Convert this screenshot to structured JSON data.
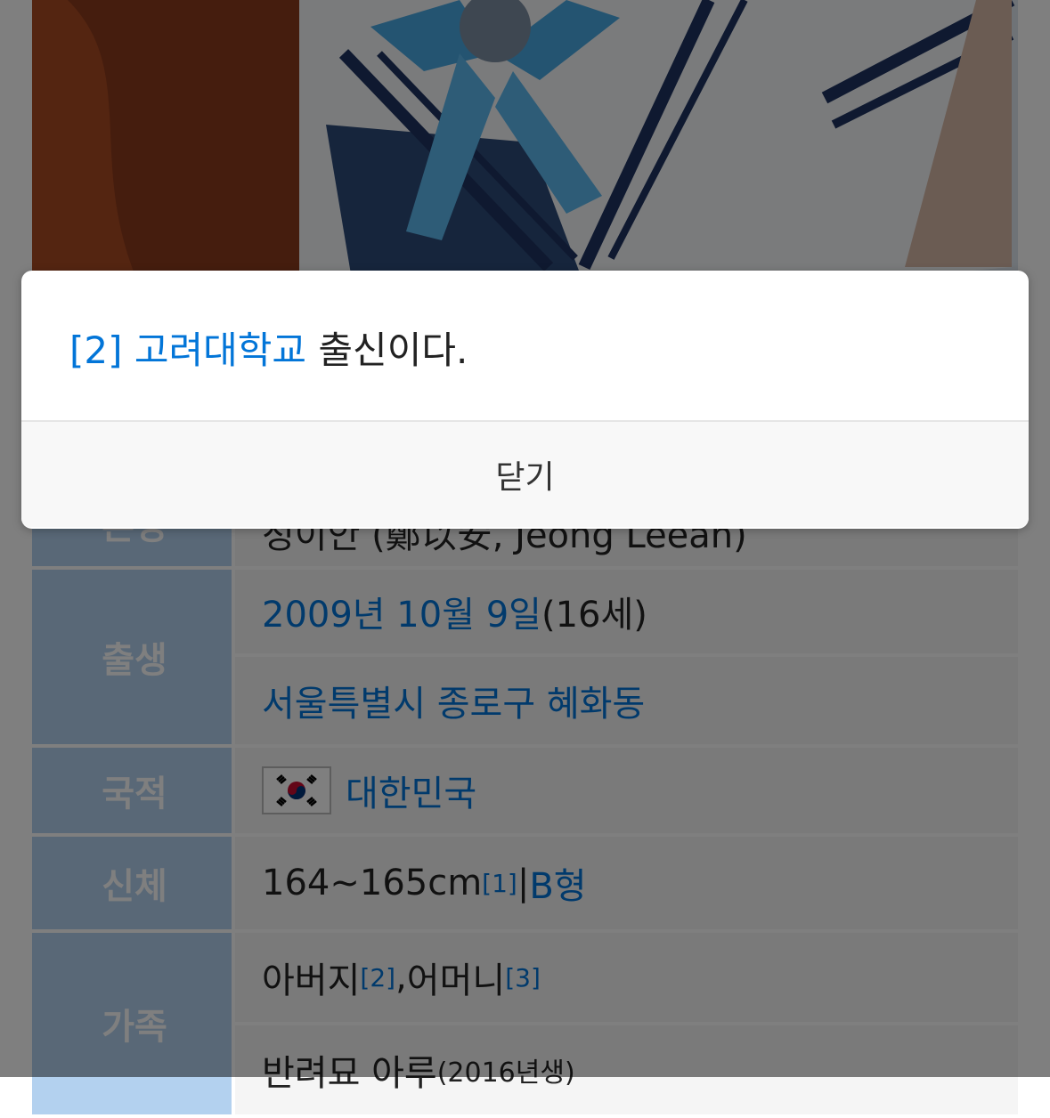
{
  "modal": {
    "footnote_ref": "[2]",
    "footnote_link": "고려대학교",
    "footnote_rest": " 출신이다.",
    "close_label": "닫기"
  },
  "infobox": {
    "name_row": {
      "label": "본명",
      "value": "정이안 (鄭以安, Jeong Leean)"
    },
    "birth_row": {
      "label": "출생",
      "date_link": "2009년 10월 9일",
      "age": " (16세)",
      "place_link": "서울특별시 종로구 혜화동"
    },
    "nationality_row": {
      "label": "국적",
      "flag_icon": "south-korea-flag",
      "country_link": "대한민국"
    },
    "body_row": {
      "label": "신체",
      "height": "164~165cm",
      "height_ref": "[1]",
      "separator": " | ",
      "blood_link": "B형"
    },
    "family_row": {
      "label": "가족",
      "father": "아버지",
      "father_ref": "[2]",
      "comma": ", ",
      "mother": "어머니",
      "mother_ref": "[3]",
      "pet": "반려묘 아루",
      "pet_note": "(2016년생)"
    }
  },
  "colors": {
    "link": "#0275d8",
    "key_bg": "#b3d1ef",
    "overlay": "rgba(0,0,0,0.5)"
  }
}
